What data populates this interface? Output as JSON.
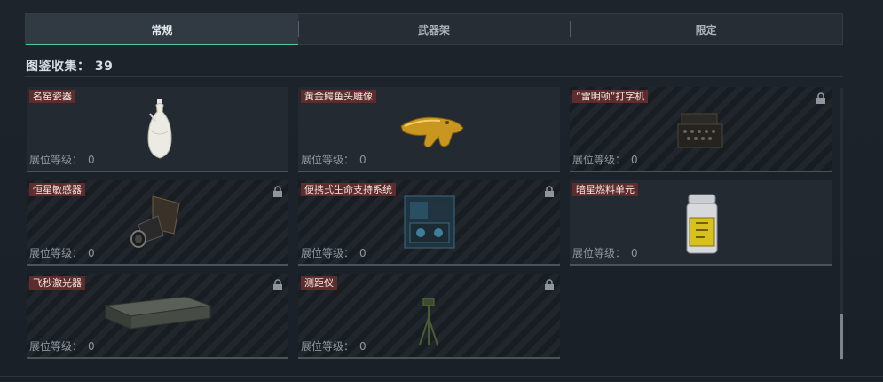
{
  "tabs": [
    {
      "label": "常规",
      "active": true
    },
    {
      "label": "武器架",
      "active": false
    },
    {
      "label": "限定",
      "active": false
    }
  ],
  "collection": {
    "label": "图鉴收集",
    "separator": "：",
    "count": "39"
  },
  "level_label": "展位等级：",
  "items": [
    {
      "name": "名窑瓷器",
      "level": "0",
      "locked": false,
      "icon": "porcelain-vase-icon"
    },
    {
      "name": "黄金鳄鱼头雕像",
      "level": "0",
      "locked": false,
      "icon": "golden-crocodile-statue-icon"
    },
    {
      "name": "“雷明顿”打字机",
      "level": "0",
      "locked": true,
      "icon": "typewriter-icon"
    },
    {
      "name": "恒星敏感器",
      "level": "0",
      "locked": true,
      "icon": "star-sensor-icon"
    },
    {
      "name": "便携式生命支持系统",
      "level": "0",
      "locked": true,
      "icon": "life-support-system-icon"
    },
    {
      "name": "暗星燃料单元",
      "level": "0",
      "locked": false,
      "icon": "fuel-cell-icon"
    },
    {
      "name": "飞秒激光器",
      "level": "0",
      "locked": true,
      "icon": "femtosecond-laser-icon"
    },
    {
      "name": "测距仪",
      "level": "0",
      "locked": true,
      "icon": "rangefinder-icon"
    }
  ],
  "colors": {
    "accent": "#55c79a",
    "name_tag": "#5e2c2d",
    "background": "#1b2128"
  }
}
